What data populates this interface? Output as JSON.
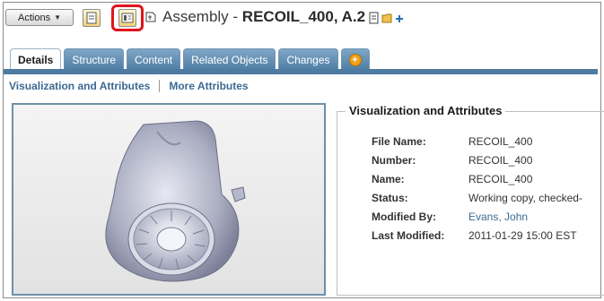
{
  "header": {
    "actions_label": "Actions",
    "title_prefix": "Assembly - ",
    "title_name": "RECOIL_400, A.2"
  },
  "tabs": [
    {
      "label": "Details",
      "active": true
    },
    {
      "label": "Structure"
    },
    {
      "label": "Content"
    },
    {
      "label": "Related Objects"
    },
    {
      "label": "Changes"
    }
  ],
  "subnav": {
    "visualization": "Visualization and Attributes",
    "more": "More Attributes"
  },
  "attributes": {
    "title": "Visualization and Attributes",
    "rows": [
      {
        "label": "File Name:",
        "value": "RECOIL_400"
      },
      {
        "label": "Number:",
        "value": "RECOIL_400"
      },
      {
        "label": "Name:",
        "value": "RECOIL_400"
      },
      {
        "label": "Status:",
        "value": "Working copy, checked-"
      },
      {
        "label": "Modified By:",
        "value": "Evans, John"
      },
      {
        "label": "Last Modified:",
        "value": "2011-01-29 15:00 EST"
      }
    ]
  },
  "colors": {
    "tab_blue": "#4f7ea4",
    "link_blue": "#3b6a93",
    "highlight_red": "#e0141b"
  }
}
